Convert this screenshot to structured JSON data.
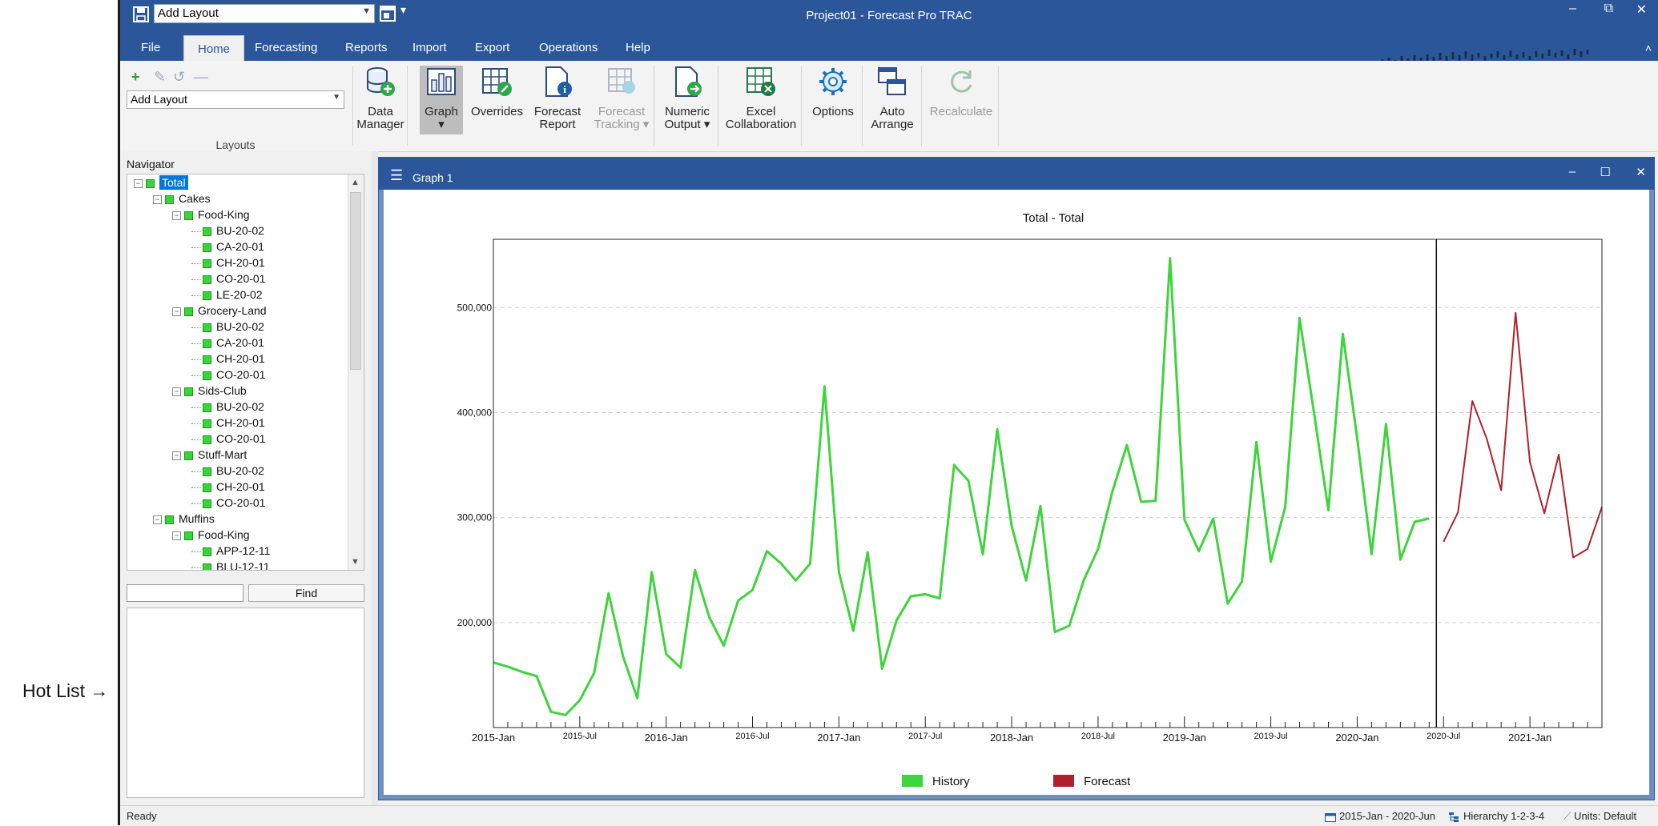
{
  "outside_label": "Hot List →",
  "quick_access": {
    "layout_value": "Add Layout"
  },
  "app_title": "Project01 - Forecast Pro TRAC",
  "window_controls": [
    "–",
    "⧉",
    "✕"
  ],
  "tabs": [
    {
      "label": "File",
      "active": false
    },
    {
      "label": "Home",
      "active": true
    },
    {
      "label": "Forecasting",
      "active": false
    },
    {
      "label": "Reports",
      "active": false
    },
    {
      "label": "Import",
      "active": false
    },
    {
      "label": "Export",
      "active": false
    },
    {
      "label": "Operations",
      "active": false
    },
    {
      "label": "Help",
      "active": false
    }
  ],
  "ribbon": {
    "layouts_group_label": "Layouts",
    "layout_select_value": "Add Layout",
    "buttons": [
      {
        "label1": "Data",
        "label2": "Manager",
        "icon": "data-manager-icon",
        "enabled": true
      },
      {
        "label1": "Graph",
        "label2": "▾",
        "icon": "graph-icon",
        "enabled": true,
        "pressed": true
      },
      {
        "label1": "Overrides",
        "label2": "",
        "icon": "overrides-icon",
        "enabled": true
      },
      {
        "label1": "Forecast",
        "label2": "Report",
        "icon": "forecast-report-icon",
        "enabled": true
      },
      {
        "label1": "Forecast",
        "label2": "Tracking ▾",
        "icon": "forecast-tracking-icon",
        "enabled": false
      },
      {
        "label1": "Numeric",
        "label2": "Output ▾",
        "icon": "numeric-output-icon",
        "enabled": true
      },
      {
        "label1": "Excel",
        "label2": "Collaboration",
        "icon": "excel-collaboration-icon",
        "enabled": true
      },
      {
        "label1": "Options",
        "label2": "",
        "icon": "options-icon",
        "enabled": true
      },
      {
        "label1": "Auto",
        "label2": "Arrange",
        "icon": "auto-arrange-icon",
        "enabled": true
      },
      {
        "label1": "Recalculate",
        "label2": "",
        "icon": "recalculate-icon",
        "enabled": false
      }
    ]
  },
  "navigator": {
    "title": "Navigator",
    "tree": [
      {
        "label": "Total",
        "level": 0,
        "type": "node",
        "selected": true
      },
      {
        "label": "Cakes",
        "level": 1,
        "type": "node"
      },
      {
        "label": "Food-King",
        "level": 2,
        "type": "node"
      },
      {
        "label": "BU-20-02",
        "level": 3,
        "type": "leaf"
      },
      {
        "label": "CA-20-01",
        "level": 3,
        "type": "leaf"
      },
      {
        "label": "CH-20-01",
        "level": 3,
        "type": "leaf"
      },
      {
        "label": "CO-20-01",
        "level": 3,
        "type": "leaf"
      },
      {
        "label": "LE-20-02",
        "level": 3,
        "type": "leaf"
      },
      {
        "label": "Grocery-Land",
        "level": 2,
        "type": "node"
      },
      {
        "label": "BU-20-02",
        "level": 3,
        "type": "leaf"
      },
      {
        "label": "CA-20-01",
        "level": 3,
        "type": "leaf"
      },
      {
        "label": "CH-20-01",
        "level": 3,
        "type": "leaf"
      },
      {
        "label": "CO-20-01",
        "level": 3,
        "type": "leaf"
      },
      {
        "label": "Sids-Club",
        "level": 2,
        "type": "node"
      },
      {
        "label": "BU-20-02",
        "level": 3,
        "type": "leaf"
      },
      {
        "label": "CH-20-01",
        "level": 3,
        "type": "leaf"
      },
      {
        "label": "CO-20-01",
        "level": 3,
        "type": "leaf"
      },
      {
        "label": "Stuff-Mart",
        "level": 2,
        "type": "node"
      },
      {
        "label": "BU-20-02",
        "level": 3,
        "type": "leaf"
      },
      {
        "label": "CH-20-01",
        "level": 3,
        "type": "leaf"
      },
      {
        "label": "CO-20-01",
        "level": 3,
        "type": "leaf"
      },
      {
        "label": "Muffins",
        "level": 1,
        "type": "node"
      },
      {
        "label": "Food-King",
        "level": 2,
        "type": "node"
      },
      {
        "label": "APP-12-11",
        "level": 3,
        "type": "leaf"
      },
      {
        "label": "BLU-12-11",
        "level": 3,
        "type": "leaf"
      }
    ],
    "find_label": "Find",
    "find_value": ""
  },
  "graph_window": {
    "title": "Graph 1"
  },
  "chart_data": {
    "type": "line",
    "title": "Total - Total",
    "xlabel": "",
    "ylabel": "",
    "ylim": [
      100000,
      565000
    ],
    "y_ticks": [
      200000,
      300000,
      400000,
      500000
    ],
    "y_tick_labels": [
      "200,000",
      "300,000",
      "400,000",
      "500,000"
    ],
    "x_major_labels": [
      {
        "label": "2015-Jan",
        "index": 0,
        "size": "large"
      },
      {
        "label": "2015-Jul",
        "index": 6,
        "size": "small"
      },
      {
        "label": "2016-Jan",
        "index": 12,
        "size": "large"
      },
      {
        "label": "2016-Jul",
        "index": 18,
        "size": "small"
      },
      {
        "label": "2017-Jan",
        "index": 24,
        "size": "large"
      },
      {
        "label": "2017-Jul",
        "index": 30,
        "size": "small"
      },
      {
        "label": "2018-Jan",
        "index": 36,
        "size": "large"
      },
      {
        "label": "2018-Jul",
        "index": 42,
        "size": "small"
      },
      {
        "label": "2019-Jan",
        "index": 48,
        "size": "large"
      },
      {
        "label": "2019-Jul",
        "index": 54,
        "size": "small"
      },
      {
        "label": "2020-Jan",
        "index": 60,
        "size": "large"
      },
      {
        "label": "2020-Jul",
        "index": 66,
        "size": "small"
      },
      {
        "label": "2021-Jan",
        "index": 72,
        "size": "large"
      }
    ],
    "x_count": 78,
    "grid": true,
    "legend_position": "bottom",
    "series": [
      {
        "name": "History",
        "color": "#3ed43c",
        "start_index": 0,
        "values": [
          162000,
          158000,
          153000,
          149000,
          115000,
          112000,
          126000,
          152000,
          228000,
          168000,
          128000,
          248000,
          170000,
          157000,
          250000,
          205000,
          178000,
          221000,
          231000,
          268000,
          256000,
          240000,
          256000,
          425000,
          248000,
          192000,
          267000,
          156000,
          202000,
          225000,
          227000,
          223000,
          350000,
          335000,
          265000,
          384000,
          292000,
          240000,
          311000,
          191000,
          197000,
          240000,
          270000,
          325000,
          369000,
          315000,
          316000,
          547000,
          298000,
          268000,
          299000,
          218000,
          239000,
          372000,
          258000,
          310000,
          490000,
          400000,
          307000,
          475000,
          376000,
          265000,
          389000,
          260000,
          296000,
          299000
        ]
      },
      {
        "name": "Forecast",
        "color": "#b0202a",
        "start_index": 66,
        "values": [
          277000,
          305000,
          411000,
          375000,
          326000,
          495000,
          353000,
          304000,
          360000,
          262000,
          270000,
          310000
        ]
      }
    ]
  },
  "status": {
    "ready": "Ready",
    "date_range": "2015-Jan - 2020-Jun",
    "hierarchy": "Hierarchy 1-2-3-4",
    "units": "Units: Default"
  }
}
